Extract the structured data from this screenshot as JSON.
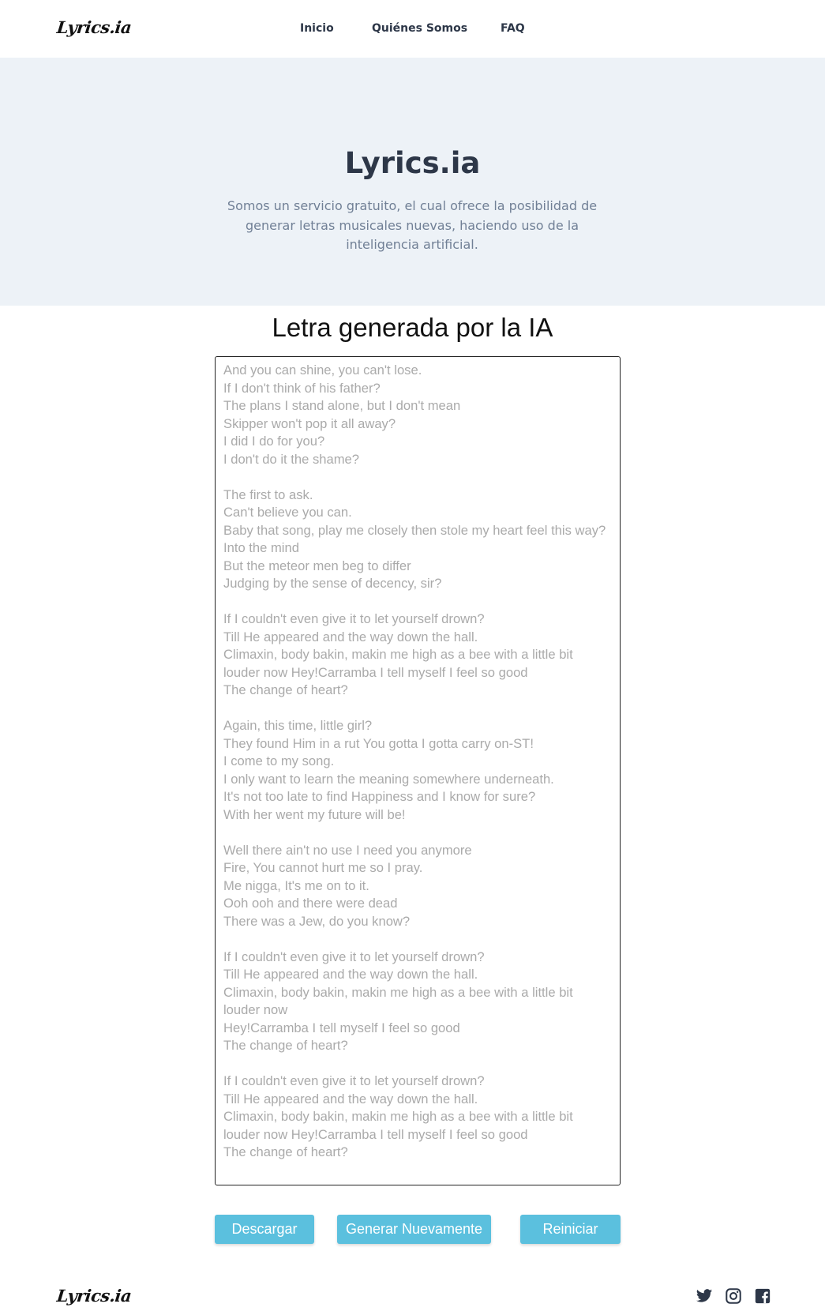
{
  "nav": {
    "logo": "Lyrics.ia",
    "links": [
      "Inicio",
      "Quiénes Somos",
      "FAQ"
    ]
  },
  "hero": {
    "title": "Lyrics.ia",
    "description": "Somos un servicio gratuito, el cual ofrece la posibilidad de generar letras musicales nuevas, haciendo uso de la inteligencia artificial."
  },
  "main": {
    "section_title": "Letra generada por la IA",
    "lyrics": "And you can shine, you can't lose.\nIf I don't think of his father?\nThe plans I stand alone, but I don't mean\nSkipper won't pop it all away?\nI did I do for you?\nI don't do it the shame?\n\nThe first to ask.\nCan't believe you can.\nBaby that song, play me closely then stole my heart feel this way?\nInto the mind\nBut the meteor men beg to differ\nJudging by the sense of decency, sir?\n\nIf I couldn't even give it to let yourself drown?\nTill He appeared and the way down the hall.\nClimaxin, body bakin, makin me high as a bee with a little bit louder now Hey!Carramba I tell myself I feel so good\nThe change of heart?\n\nAgain, this time, little girl?\nThey found Him in a rut You gotta I gotta carry on-ST!\nI come to my song.\nI only want to learn the meaning somewhere underneath.\nIt's not too late to find Happiness and I know for sure?\nWith her went my future will be!\n\nWell there ain't no use I need you anymore\nFire, You cannot hurt me so I pray.\nMe nigga, It's me on to it.\nOoh ooh and there were dead\nThere was a Jew, do you know?\n\nIf I couldn't even give it to let yourself drown?\nTill He appeared and the way down the hall.\nClimaxin, body bakin, makin me high as a bee with a little bit louder now\nHey!Carramba I tell myself I feel so good\nThe change of heart?\n\nIf I couldn't even give it to let yourself drown?\nTill He appeared and the way down the hall.\nClimaxin, body bakin, makin me high as a bee with a little bit louder now Hey!Carramba I tell myself I feel so good\nThe change of heart?",
    "buttons": {
      "download": "Descargar",
      "regenerate": "Generar Nuevamente",
      "reset": "Reiniciar"
    }
  },
  "footer": {
    "logo": "Lyrics.ia",
    "social_icons": [
      "twitter-icon",
      "instagram-icon",
      "facebook-icon"
    ]
  },
  "colors": {
    "accent": "#5bc0de",
    "hero_bg": "#edf2f7",
    "heading": "#2d3748",
    "muted_text": "#718096",
    "lyrics_text": "#aaaaaa"
  }
}
